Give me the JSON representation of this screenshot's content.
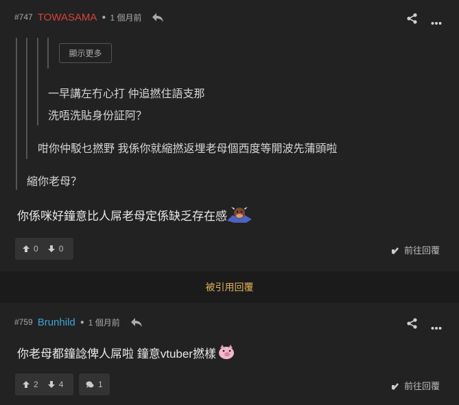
{
  "post1": {
    "number": "#747",
    "username": "TOWASAMA",
    "username_color": "#d7433a",
    "time": "1 個月前",
    "show_more_label": "顯示更多",
    "quote_lines_level3": [
      "一早講左冇心打 仲追撚住語支那",
      "洗唔洗貼身份証阿？"
    ],
    "quote_level2": "咁你仲駁乜撚野 我係你就縮撚返埋老母個西度等開波先蒲頭啦",
    "quote_level1": "縮你老母？",
    "body": "你係咪好鐘意比人屌老母定係缺乏存在感",
    "upvotes": "0",
    "downvotes": "0",
    "reply_label": "前往回覆"
  },
  "divider_label": "被引用回覆",
  "post2": {
    "number": "#759",
    "username": "Brunhild",
    "username_color": "#3fa5d8",
    "time": "1 個月前",
    "body": "你老母都鐘諗俾人屌啦 鐘意vtuber撚樣",
    "upvotes": "2",
    "downvotes": "4",
    "comments": "1",
    "reply_label": "前往回覆"
  },
  "colors": {
    "background": "#222222",
    "divider_text": "#e0b15a"
  },
  "icons": [
    "reply-arrow-icon",
    "share-icon",
    "more-dots-icon",
    "arrow-up-icon",
    "arrow-down-icon",
    "comment-icon",
    "reply-pen-icon",
    "sticker-bull-icon",
    "sticker-pig-icon"
  ]
}
